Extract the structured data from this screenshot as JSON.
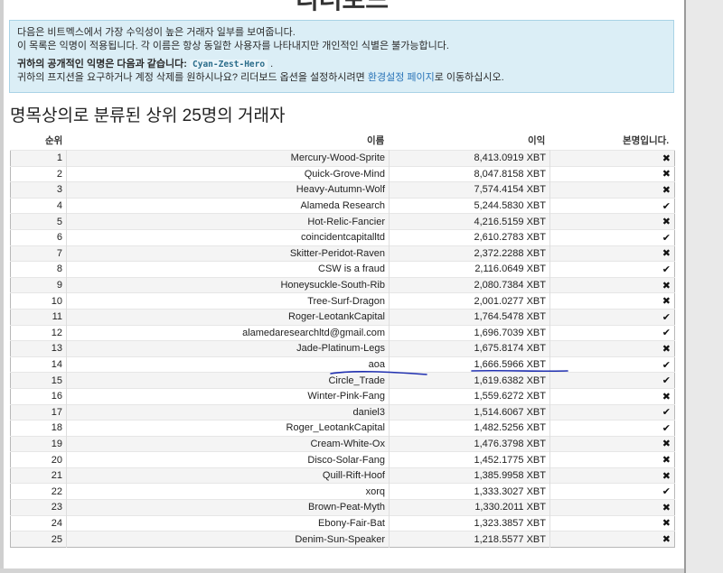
{
  "page": {
    "top_title": "리더보드"
  },
  "info": {
    "line1": "다음은 비트멕스에서 가장 수익성이 높은 거래자 일부를 보여줍니다.",
    "line2": "이 목록은 익명이 적용됩니다. 각 이름은 항상 동일한 사용자를 나타내지만 개인적인 식별은 불가능합니다.",
    "anon_label": "귀하의 공개적인 익명은 다음과 같습니다:",
    "anon_name": "Cyan-Zest-Hero",
    "anon_period": ".",
    "line4_prefix": "귀하의 프지션을 요구하거나 계정 삭제를 원하시나요? 리더보드 옵션을 설정하시려면",
    "line4_link": "환경설정 페이지",
    "line4_suffix": "로 이동하십시오."
  },
  "section_title": "명목상의로 분류된 상위 25명의 거래자",
  "table": {
    "headers": {
      "rank": "순위",
      "name": "이름",
      "profit": "이익",
      "identified": "본명입니다."
    },
    "rows": [
      {
        "rank": "1",
        "name": "Mercury-Wood-Sprite",
        "profit": "8,413.0919 XBT",
        "identified": "no"
      },
      {
        "rank": "2",
        "name": "Quick-Grove-Mind",
        "profit": "8,047.8158 XBT",
        "identified": "no"
      },
      {
        "rank": "3",
        "name": "Heavy-Autumn-Wolf",
        "profit": "7,574.4154 XBT",
        "identified": "no"
      },
      {
        "rank": "4",
        "name": "Alameda Research",
        "profit": "5,244.5830 XBT",
        "identified": "yes"
      },
      {
        "rank": "5",
        "name": "Hot-Relic-Fancier",
        "profit": "4,216.5159 XBT",
        "identified": "no"
      },
      {
        "rank": "6",
        "name": "coincidentcapitalltd",
        "profit": "2,610.2783 XBT",
        "identified": "yes"
      },
      {
        "rank": "7",
        "name": "Skitter-Peridot-Raven",
        "profit": "2,372.2288 XBT",
        "identified": "no"
      },
      {
        "rank": "8",
        "name": "CSW is a fraud",
        "profit": "2,116.0649 XBT",
        "identified": "yes"
      },
      {
        "rank": "9",
        "name": "Honeysuckle-South-Rib",
        "profit": "2,080.7384 XBT",
        "identified": "no"
      },
      {
        "rank": "10",
        "name": "Tree-Surf-Dragon",
        "profit": "2,001.0277 XBT",
        "identified": "no"
      },
      {
        "rank": "11",
        "name": "Roger-LeotankCapital",
        "profit": "1,764.5478 XBT",
        "identified": "yes"
      },
      {
        "rank": "12",
        "name": "alamedaresearchltd@gmail.com",
        "profit": "1,696.7039 XBT",
        "identified": "yes"
      },
      {
        "rank": "13",
        "name": "Jade-Platinum-Legs",
        "profit": "1,675.8174 XBT",
        "identified": "no"
      },
      {
        "rank": "14",
        "name": "aoa",
        "profit": "1,666.5966 XBT",
        "identified": "yes"
      },
      {
        "rank": "15",
        "name": "Circle_Trade",
        "profit": "1,619.6382 XBT",
        "identified": "yes"
      },
      {
        "rank": "16",
        "name": "Winter-Pink-Fang",
        "profit": "1,559.6272 XBT",
        "identified": "no"
      },
      {
        "rank": "17",
        "name": "daniel3",
        "profit": "1,514.6067 XBT",
        "identified": "yes"
      },
      {
        "rank": "18",
        "name": "Roger_LeotankCapital",
        "profit": "1,482.5256 XBT",
        "identified": "yes"
      },
      {
        "rank": "19",
        "name": "Cream-White-Ox",
        "profit": "1,476.3798 XBT",
        "identified": "no"
      },
      {
        "rank": "20",
        "name": "Disco-Solar-Fang",
        "profit": "1,452.1775 XBT",
        "identified": "no"
      },
      {
        "rank": "21",
        "name": "Quill-Rift-Hoof",
        "profit": "1,385.9958 XBT",
        "identified": "no"
      },
      {
        "rank": "22",
        "name": "xorq",
        "profit": "1,333.3027 XBT",
        "identified": "yes"
      },
      {
        "rank": "23",
        "name": "Brown-Peat-Myth",
        "profit": "1,330.2011 XBT",
        "identified": "no"
      },
      {
        "rank": "24",
        "name": "Ebony-Fair-Bat",
        "profit": "1,323.3857 XBT",
        "identified": "no"
      },
      {
        "rank": "25",
        "name": "Denim-Sun-Speaker",
        "profit": "1,218.5577 XBT",
        "identified": "no"
      }
    ]
  },
  "icons": {
    "yes": "check-icon",
    "no": "cross-icon"
  },
  "colors": {
    "info_bg": "#dbeef6",
    "link": "#2a74b8",
    "annotation_pen": "#1f2fb0"
  }
}
